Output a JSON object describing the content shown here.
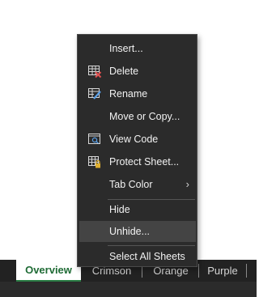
{
  "menu": {
    "items": [
      {
        "label": "Insert..."
      },
      {
        "label": "Delete"
      },
      {
        "label": "Rename"
      },
      {
        "label": "Move or Copy..."
      },
      {
        "label": "View Code"
      },
      {
        "label": "Protect Sheet..."
      },
      {
        "label": "Tab Color",
        "has_submenu": true
      },
      {
        "label": "Hide"
      },
      {
        "label": "Unhide...",
        "highlighted": true
      },
      {
        "label": "Select All Sheets"
      }
    ],
    "submenu_arrow": "›"
  },
  "sheet_tabs": [
    {
      "label": "Overview",
      "active": true
    },
    {
      "label": "Crimson"
    },
    {
      "label": "Orange"
    },
    {
      "label": "Purple"
    }
  ],
  "colors": {
    "menu_bg": "#2b2b2b",
    "hover_bg": "#444444",
    "active_tab_text": "#1f6b35",
    "active_tab_underline": "#2b7d45",
    "delete_icon_x": "#e05050",
    "rename_icon_pen": "#5aa0e8",
    "protect_icon_lock": "#e0b030"
  }
}
